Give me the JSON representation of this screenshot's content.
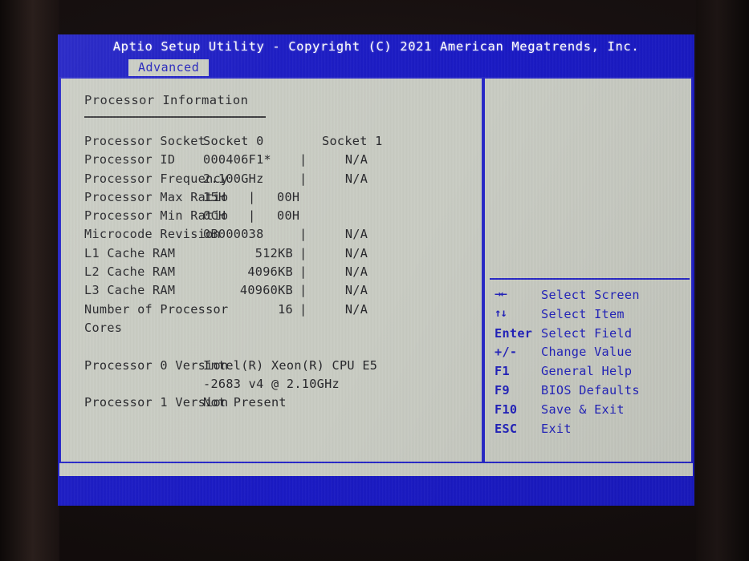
{
  "colors": {
    "screen_blue": "#1a1ac4",
    "panel_gray": "#c9ccc3",
    "border_blue": "#2828c8",
    "legend_text": "#2222bb",
    "body_text": "#26262a"
  },
  "header": {
    "title": "Aptio Setup Utility - Copyright (C) 2021 American Megatrends, Inc.",
    "tabs": [
      {
        "label": "Advanced",
        "active": true
      }
    ]
  },
  "main": {
    "section_title": "Processor Information",
    "column_headers": {
      "socket0": "Socket 0",
      "socket1": "Socket 1"
    },
    "rows": [
      {
        "label": "Processor Socket",
        "socket0": "Socket 0",
        "separator": "",
        "socket1": "Socket 1"
      },
      {
        "label": "Processor ID",
        "socket0": "000406F1*",
        "separator": "|",
        "socket1": "N/A"
      },
      {
        "label": "Processor Frequency",
        "socket0": "2.100GHz",
        "separator": "|",
        "socket1": "N/A"
      },
      {
        "label": "Processor Max Ratio",
        "socket0": "15H",
        "separator": "|",
        "socket1": "00H"
      },
      {
        "label": "Processor Min Ratio",
        "socket0": "0CH",
        "separator": "|",
        "socket1": "00H"
      },
      {
        "label": "Microcode Revision",
        "socket0": "0B000038",
        "separator": "|",
        "socket1": "N/A"
      },
      {
        "label": "L1 Cache RAM",
        "socket0": "512KB",
        "separator": "|",
        "socket1": "N/A"
      },
      {
        "label": "L2 Cache RAM",
        "socket0": "4096KB",
        "separator": "|",
        "socket1": "N/A"
      },
      {
        "label": "L3 Cache RAM",
        "socket0": "40960KB",
        "separator": "|",
        "socket1": "N/A"
      },
      {
        "label": "Number of Processor",
        "socket0": "16",
        "separator": "|",
        "socket1": "N/A"
      },
      {
        "label": "Cores",
        "socket0": "",
        "separator": "",
        "socket1": ""
      },
      {
        "label": "",
        "socket0": "",
        "separator": "",
        "socket1": ""
      },
      {
        "label": "Processor 0 Version",
        "socket0": "Intel(R) Xeon(R) CPU E5",
        "separator": "",
        "socket1": ""
      },
      {
        "label": "",
        "socket0": "-2683 v4 @ 2.10GHz",
        "separator": "",
        "socket1": ""
      },
      {
        "label": "Processor 1 Version",
        "socket0": "Not Present",
        "separator": "",
        "socket1": ""
      }
    ]
  },
  "legend": {
    "items": [
      {
        "key": "→←",
        "icon": "left-right-arrow-icon",
        "desc": "Select Screen"
      },
      {
        "key": "↑↓",
        "icon": "up-down-arrow-icon",
        "desc": "Select Item"
      },
      {
        "key": "Enter",
        "icon": "enter-key",
        "desc": "Select Field"
      },
      {
        "key": "+/-",
        "icon": "plus-minus-key",
        "desc": "Change Value"
      },
      {
        "key": "F1",
        "icon": "f1-key",
        "desc": "General Help"
      },
      {
        "key": "F9",
        "icon": "f9-key",
        "desc": "BIOS Defaults"
      },
      {
        "key": "F10",
        "icon": "f10-key",
        "desc": "Save & Exit"
      },
      {
        "key": "ESC",
        "icon": "esc-key",
        "desc": "Exit"
      }
    ]
  }
}
